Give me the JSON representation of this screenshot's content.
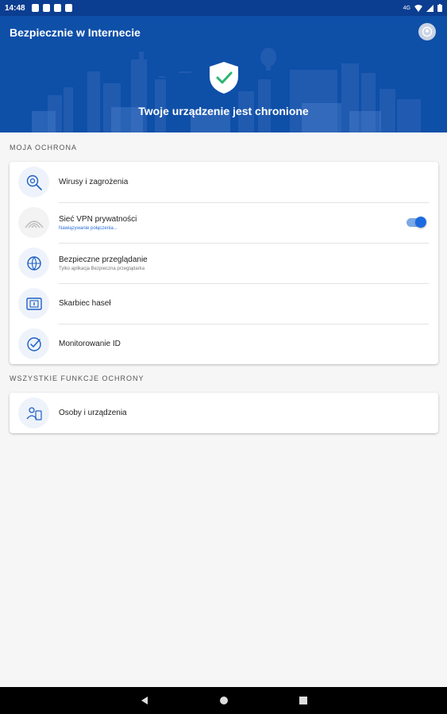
{
  "statusbar": {
    "time": "14:48",
    "network": "4G"
  },
  "header": {
    "title": "Bezpiecznie w Internecie",
    "status": "Twoje urządzenie jest chronione"
  },
  "sections": {
    "my_protection": {
      "title": "MOJA OCHRONA",
      "items": [
        {
          "label": "Wirusy i zagrożenia",
          "sub": ""
        },
        {
          "label": "Sieć VPN prywatności",
          "sub": "Nawiązywanie połączenia...",
          "toggle": true
        },
        {
          "label": "Bezpieczne przeglądanie",
          "sub": "Tylko aplikacja Bezpieczna przeglądarka"
        },
        {
          "label": "Skarbiec haseł",
          "sub": ""
        },
        {
          "label": "Monitorowanie ID",
          "sub": ""
        }
      ]
    },
    "all_features": {
      "title": "WSZYSTKIE FUNKCJE OCHRONY",
      "items": [
        {
          "label": "Osoby i urządzenia",
          "sub": ""
        }
      ]
    }
  },
  "colors": {
    "header_bg": "#0e4fa8",
    "accent": "#1d6ae0",
    "page_bg": "#f6f6f6"
  },
  "icons": {
    "viruses": "virus-search-icon",
    "vpn": "vpn-arc-icon",
    "browsing": "globe-shield-icon",
    "vault": "vault-icon",
    "id": "id-monitor-icon",
    "people": "people-devices-icon"
  }
}
